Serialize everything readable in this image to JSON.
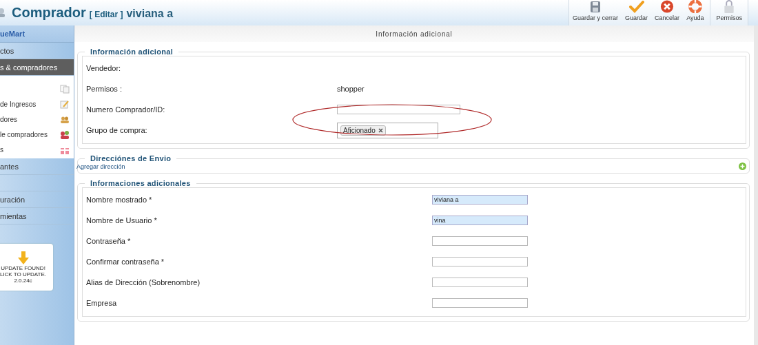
{
  "header": {
    "title": "Comprador",
    "edit_label": "[ Editar ]",
    "subject": "viviana a"
  },
  "toolbar": [
    {
      "label": "Guardar y cerrar",
      "kind": "save-close"
    },
    {
      "label": "Guardar",
      "kind": "save"
    },
    {
      "label": "Cancelar",
      "kind": "cancel"
    },
    {
      "label": "Ayuda",
      "kind": "help"
    },
    {
      "label": "Permisos",
      "kind": "permissions"
    }
  ],
  "sidebar": {
    "logo": "ueMart",
    "items": [
      {
        "label": "ctos",
        "selected": false
      },
      {
        "label": "s & compradores",
        "selected": true,
        "children": [
          {
            "kind": "copy"
          },
          {
            "label": "de Ingresos",
            "kind": "edit"
          },
          {
            "label": "dores",
            "kind": "people"
          },
          {
            "label": "le compradores",
            "kind": "group"
          },
          {
            "label": "s",
            "kind": "gift"
          }
        ]
      },
      {
        "label": "antes",
        "selected": false
      },
      {
        "selected": false
      },
      {
        "label": "uración",
        "selected": false
      },
      {
        "label": "mientas",
        "selected": false
      }
    ],
    "update": {
      "lines": [
        "UPDATE FOUND!",
        "LICK TO UPDATE.",
        "2.0.24c"
      ]
    }
  },
  "page_heading": "Información adicional",
  "sections": [
    {
      "legend": "Información adicional",
      "kind": "fields",
      "rows": [
        {
          "label": "Vendedor:",
          "kind": "empty"
        },
        {
          "label": "Permisos :",
          "kind": "text",
          "value": "shopper"
        },
        {
          "label": "Numero Comprador/ID:",
          "kind": "input",
          "highlighted": false,
          "circled": true
        },
        {
          "label": "Grupo de compra:",
          "kind": "tags",
          "tags": [
            "Aficionado"
          ]
        }
      ]
    },
    {
      "legend": "Direcciónes de Envio",
      "kind": "links",
      "link": "Agregar dirección"
    },
    {
      "legend": "Informaciones adicionales",
      "kind": "fields",
      "rows": [
        {
          "label": "Nombre mostrado *",
          "kind": "input",
          "value": "viviana a",
          "highlighted": true
        },
        {
          "label": "Nombre de Usuario *",
          "kind": "input",
          "value": "vina",
          "highlighted": true
        },
        {
          "label": "Contraseña *",
          "kind": "input",
          "highlighted": false
        },
        {
          "label": "Confirmar contraseña *",
          "kind": "input",
          "highlighted": false
        },
        {
          "label": "Alias de Dirección (Sobrenombre)",
          "kind": "input",
          "highlighted": false
        },
        {
          "label": "Empresa",
          "kind": "input",
          "highlighted": false
        }
      ]
    }
  ]
}
